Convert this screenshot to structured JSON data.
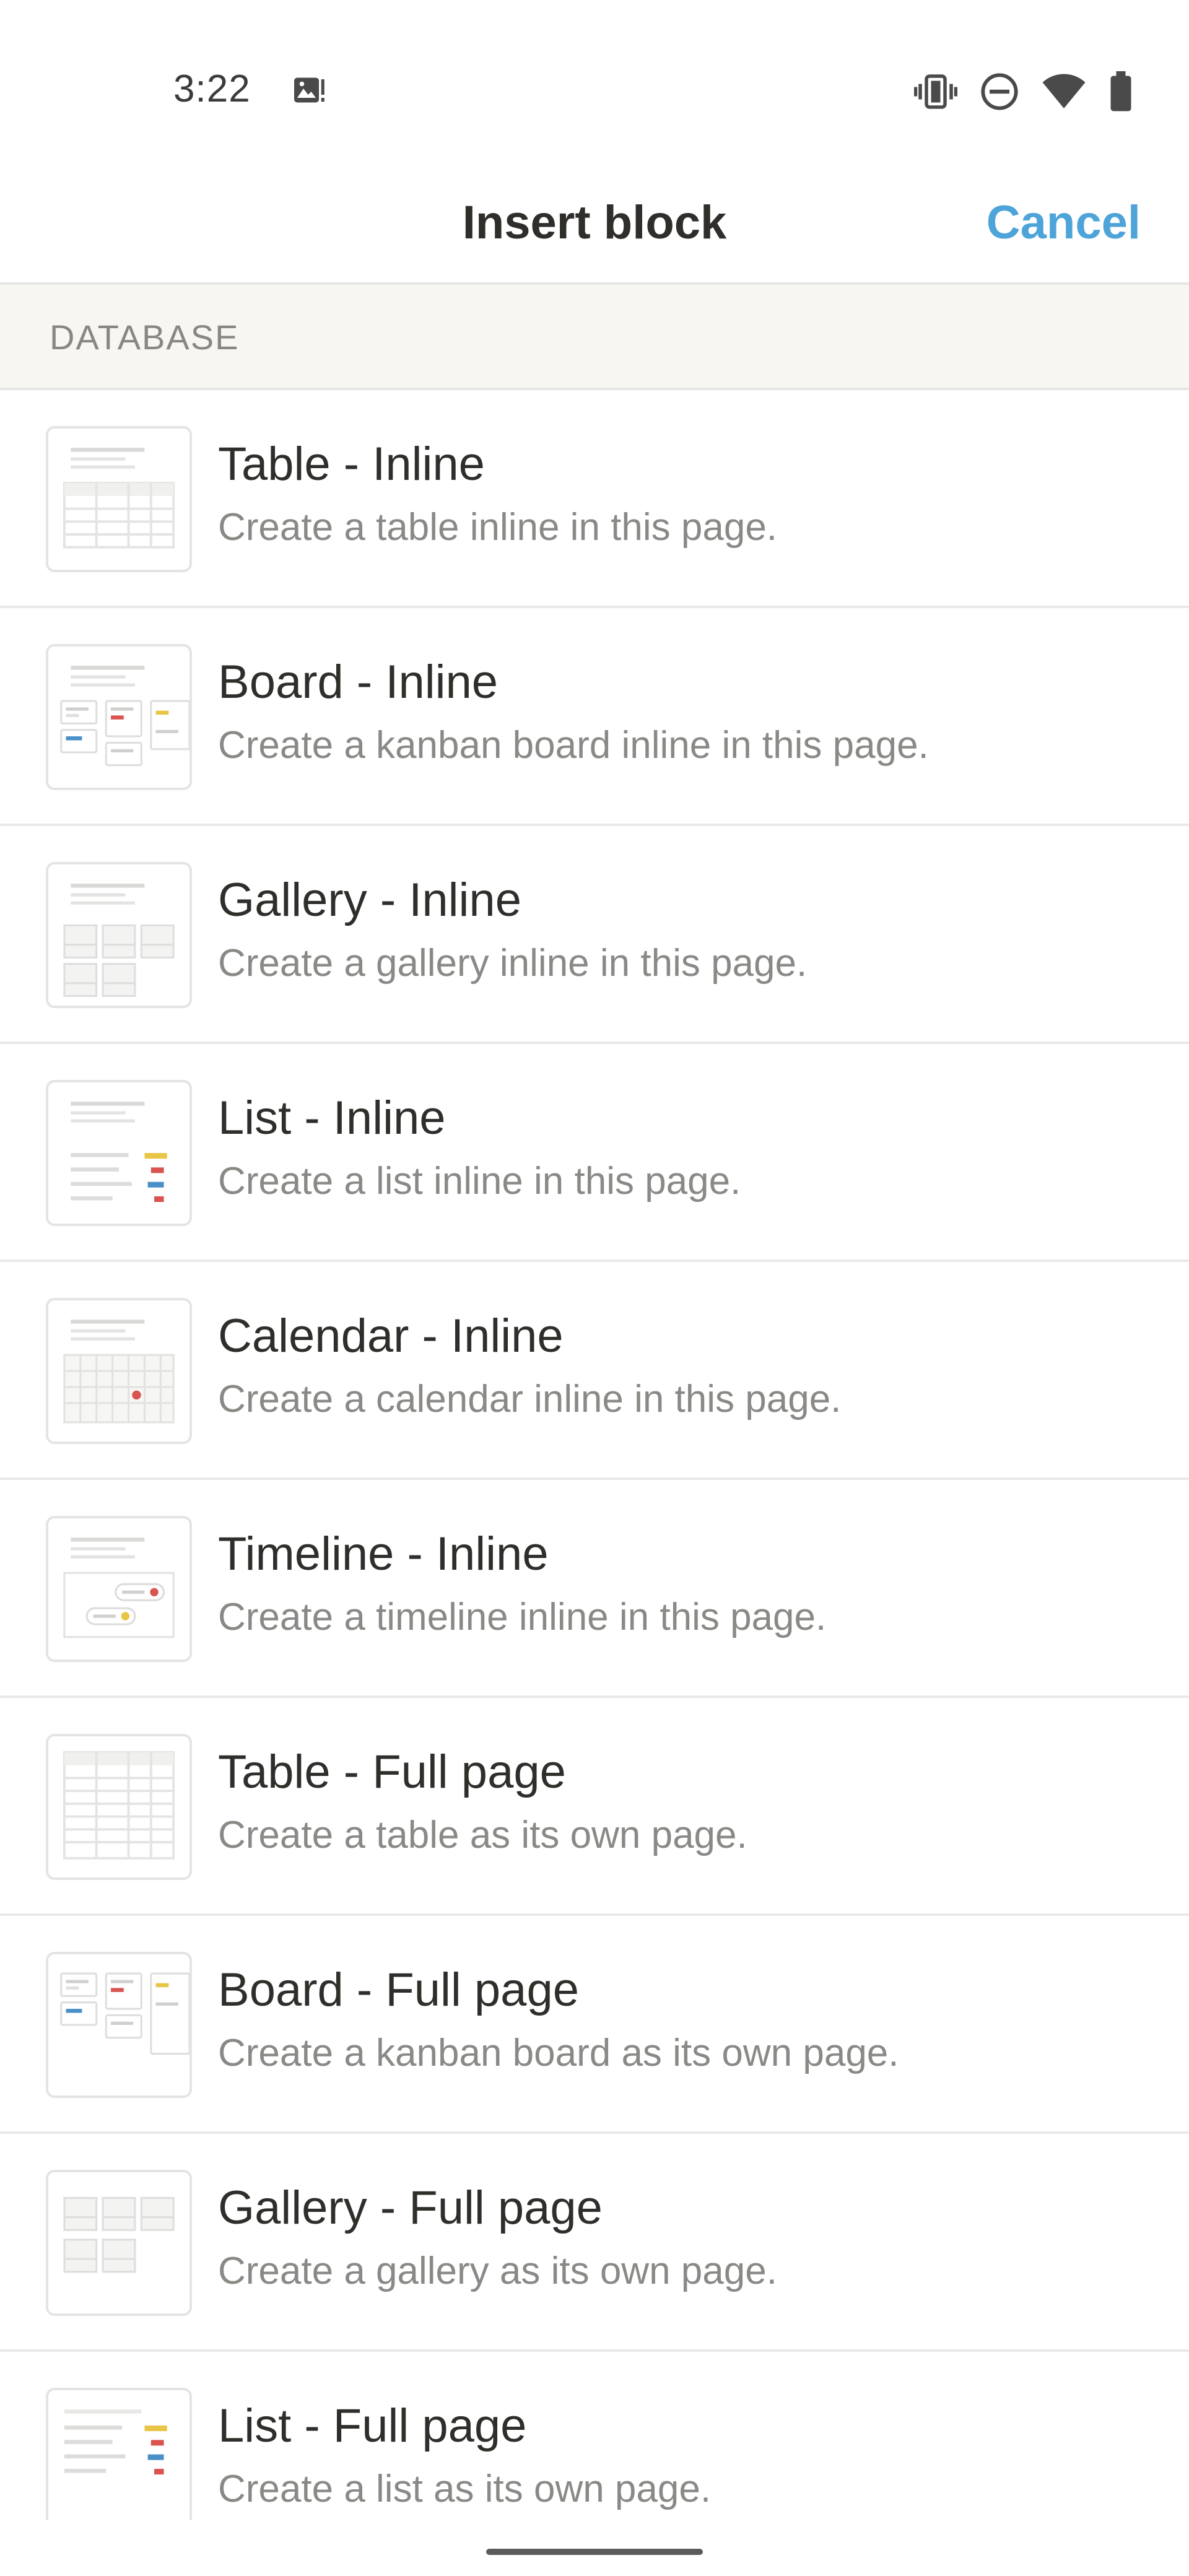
{
  "status_bar": {
    "time": "3:22",
    "icons": [
      "image-notification-icon",
      "vibrate-icon",
      "do-not-disturb-icon",
      "wifi-icon",
      "battery-icon"
    ]
  },
  "header": {
    "title": "Insert block",
    "cancel_label": "Cancel",
    "accent_color": "#4ea4d9"
  },
  "section": {
    "label": "DATABASE"
  },
  "items": [
    {
      "title": "Table - Inline",
      "description": "Create a table inline in this page.",
      "icon": "table-inline-icon"
    },
    {
      "title": "Board - Inline",
      "description": "Create a kanban board inline in this page.",
      "icon": "board-inline-icon"
    },
    {
      "title": "Gallery - Inline",
      "description": "Create a gallery inline in this page.",
      "icon": "gallery-inline-icon"
    },
    {
      "title": "List - Inline",
      "description": "Create a list inline in this page.",
      "icon": "list-inline-icon"
    },
    {
      "title": "Calendar - Inline",
      "description": "Create a calendar inline in this page.",
      "icon": "calendar-inline-icon"
    },
    {
      "title": "Timeline - Inline",
      "description": "Create a timeline inline in this page.",
      "icon": "timeline-inline-icon"
    },
    {
      "title": "Table - Full page",
      "description": "Create a table as its own page.",
      "icon": "table-full-page-icon"
    },
    {
      "title": "Board - Full page",
      "description": "Create a kanban board as its own page.",
      "icon": "board-full-page-icon"
    },
    {
      "title": "Gallery - Full page",
      "description": "Create a gallery as its own page.",
      "icon": "gallery-full-page-icon"
    },
    {
      "title": "List - Full page",
      "description": "Create a list as its own page.",
      "icon": "list-full-page-icon"
    }
  ]
}
